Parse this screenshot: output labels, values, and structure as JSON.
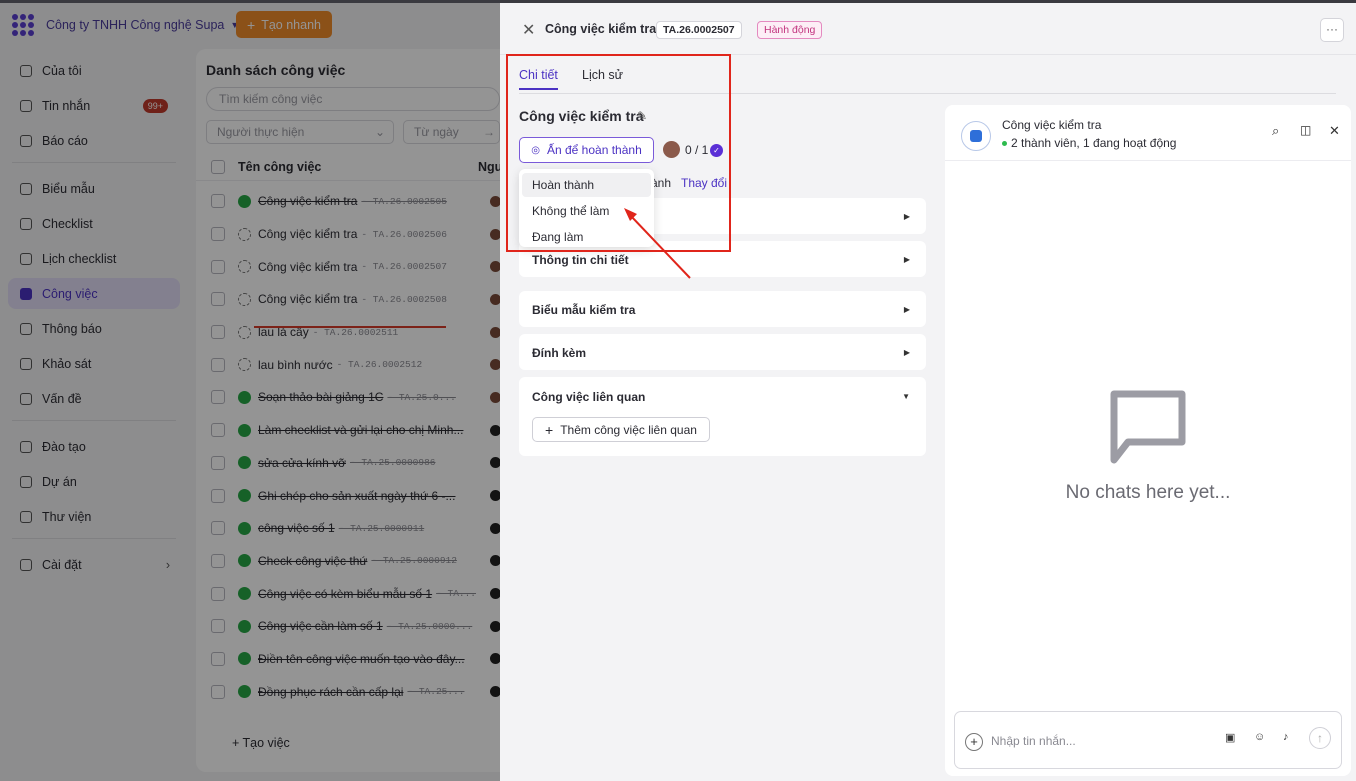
{
  "sidebar": {
    "company": "Công ty TNHH Công nghệ Supa",
    "quick_create": "Tạo nhanh",
    "items": [
      {
        "label": "Của tôi"
      },
      {
        "label": "Tin nhắn",
        "badge": "99+"
      },
      {
        "label": "Báo cáo"
      },
      {
        "label": "Biểu mẫu"
      },
      {
        "label": "Checklist"
      },
      {
        "label": "Lịch checklist"
      },
      {
        "label": "Công việc"
      },
      {
        "label": "Thông báo"
      },
      {
        "label": "Khảo sát"
      },
      {
        "label": "Vấn đề"
      },
      {
        "label": "Đào tạo"
      },
      {
        "label": "Dự án"
      },
      {
        "label": "Thư viện"
      },
      {
        "label": "Cài đặt"
      }
    ]
  },
  "task_list": {
    "title": "Danh sách công việc",
    "search_placeholder": "Tìm kiếm công việc",
    "filter_assignee": "Người thực hiện",
    "filter_from": "Từ ngày",
    "col_name": "Tên công việc",
    "col_assignee": "Ngư",
    "add_task": "Tạo việc",
    "rows": [
      {
        "name": "Công việc kiểm tra",
        "code": "- TA.26.0002505",
        "status": "done"
      },
      {
        "name": "Công việc kiểm tra",
        "code": "- TA.26.0002506",
        "status": "todo"
      },
      {
        "name": "Công việc kiểm tra",
        "code": "- TA.26.0002507",
        "status": "todo"
      },
      {
        "name": "Công việc kiểm tra",
        "code": "- TA.26.0002508",
        "status": "todo"
      },
      {
        "name": "lau lá cây",
        "code": "- TA.26.0002511",
        "status": "todo"
      },
      {
        "name": "lau bình nước",
        "code": "- TA.26.0002512",
        "status": "todo"
      },
      {
        "name": "Soạn thảo bài giảng 1C",
        "code": "- TA.25.0...",
        "status": "done"
      },
      {
        "name": "Làm checklist và gửi lại cho chị Minh...",
        "code": "",
        "status": "done"
      },
      {
        "name": "sửa cửa kính vỡ",
        "code": "- TA.25.0000986",
        "status": "done"
      },
      {
        "name": "Ghi chép cho sản xuất ngày thứ 6 -...",
        "code": "",
        "status": "done"
      },
      {
        "name": "công việc số 1",
        "code": "- TA.25.0000911",
        "status": "done"
      },
      {
        "name": "Check công việc thứ",
        "code": "- TA.25.0000912",
        "status": "done"
      },
      {
        "name": "Công việc có kèm biểu mẫu số 1",
        "code": "- TA...",
        "status": "done"
      },
      {
        "name": "Công việc cần làm số 1",
        "code": "- TA.25.0000...",
        "status": "done"
      },
      {
        "name": "Điền tên công việc muốn tạo vào đây...",
        "code": "",
        "status": "done"
      },
      {
        "name": "Đồng phục rách cần cấp lại",
        "code": "- TA.25...",
        "status": "done"
      }
    ]
  },
  "drawer": {
    "title": "Công việc kiểm tra",
    "code": "TA.26.0002507",
    "tag": "Hành động",
    "more": "···",
    "tabs": [
      "Chi tiết",
      "Lịch sử"
    ],
    "task_title": "Công việc kiểm tra",
    "complete_button": "Ấn để hoàn thành",
    "progress": "0 / 1",
    "status_fragment": "ành",
    "change_link": "Thay đổi",
    "status_menu": [
      "Hoàn thành",
      "Không thể làm",
      "Đang làm"
    ],
    "sections": [
      "Thông tin chi tiết",
      "Biểu mẫu kiểm tra",
      "Đính kèm",
      "Công việc liên quan"
    ],
    "add_related": "Thêm công việc liên quan"
  },
  "chat": {
    "name": "Công việc kiểm tra",
    "subtitle": "2 thành viên, 1 đang hoạt động",
    "empty_text": "No chats here yet...",
    "placeholder": "Nhập tin nhắn..."
  },
  "colors": {
    "accent": "#4b32c3",
    "highlight_box": "#e0251b",
    "done": "#27a745",
    "quick_create": "#f08c2a"
  }
}
